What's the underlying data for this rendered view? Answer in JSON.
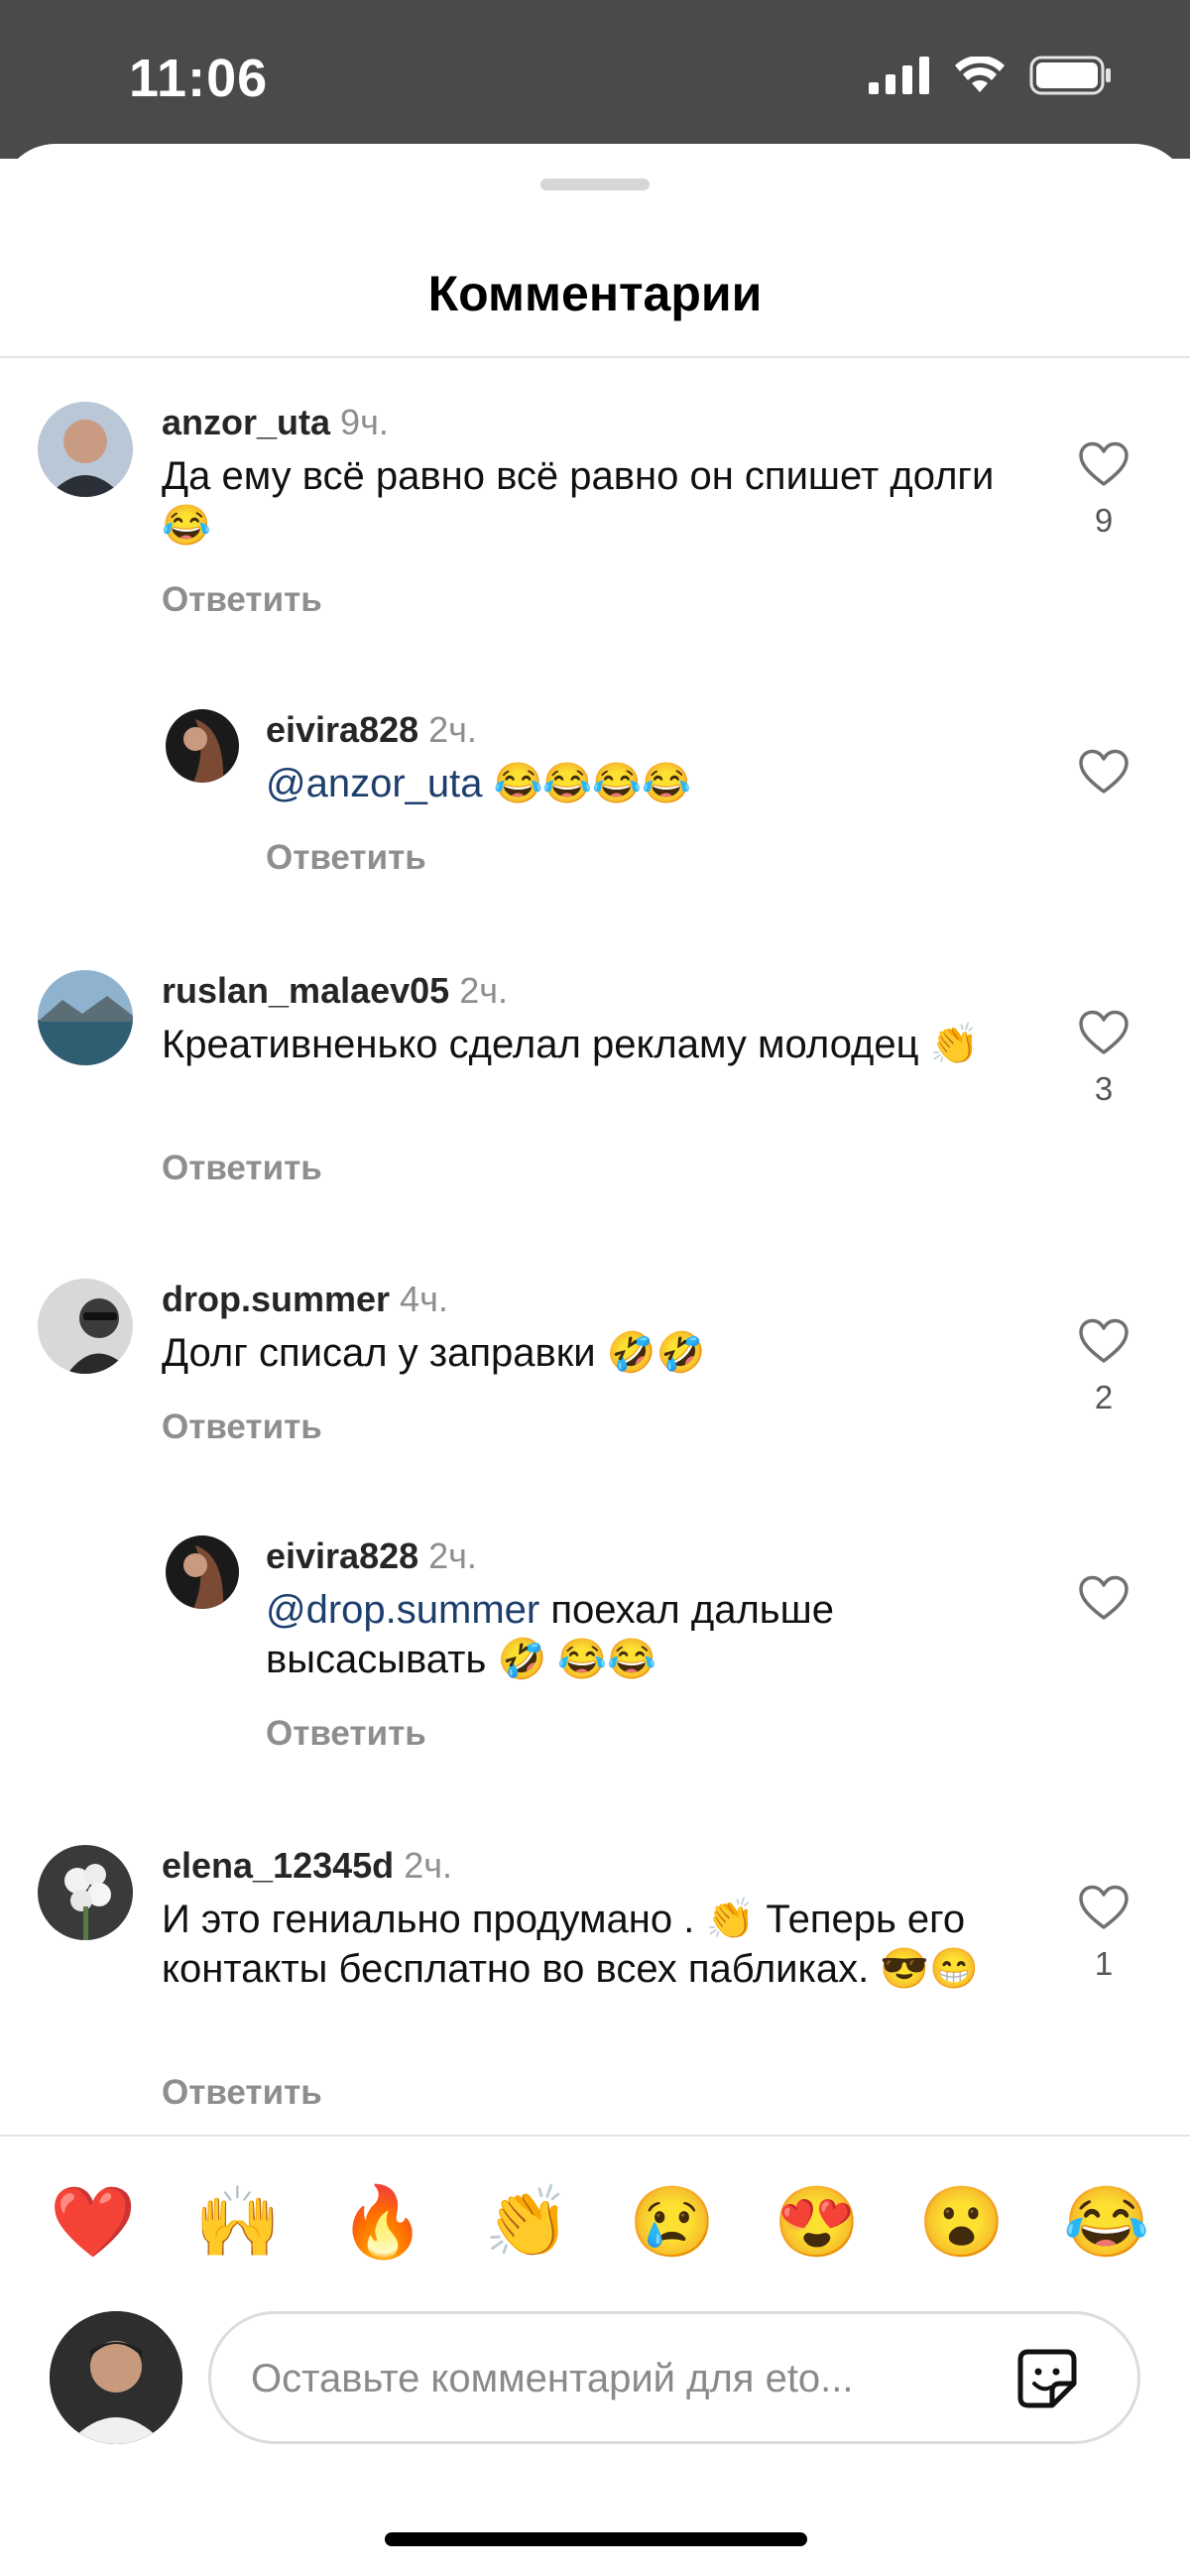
{
  "status_bar": {
    "time": "11:06"
  },
  "sheet": {
    "title": "Комментарии"
  },
  "comments": [
    {
      "username": "anzor_uta",
      "time": "9ч.",
      "text": "Да ему всё равно всё равно он спишет долги😂",
      "reply": "Ответить",
      "likes": "9"
    },
    {
      "username": "eivira828",
      "time": "2ч.",
      "mention": "@anzor_uta",
      "text": " 😂😂😂😂",
      "reply": "Ответить",
      "likes": ""
    },
    {
      "username": "ruslan_malaev05",
      "time": "2ч.",
      "text": "Креативненько сделал рекламу молодец 👏",
      "reply": "Ответить",
      "likes": "3"
    },
    {
      "username": "drop.summer",
      "time": "4ч.",
      "text": "Долг списал у заправки 🤣🤣",
      "reply": "Ответить",
      "likes": "2"
    },
    {
      "username": "eivira828",
      "time": "2ч.",
      "mention": "@drop.summer",
      "text": " поехал дальше высасывать 🤣 😂😂",
      "reply": "Ответить",
      "likes": ""
    },
    {
      "username": "elena_12345d",
      "time": "2ч.",
      "text": "И это гениально продумано . 👏 Теперь его контакты бесплатно во всех пабликах. 😎😁",
      "reply": "Ответить",
      "likes": "1"
    }
  ],
  "quick_reactions": [
    "❤️",
    "🙌",
    "🔥",
    "👏",
    "😢",
    "😍",
    "😮",
    "😂"
  ],
  "composer": {
    "placeholder": "Оставьте комментарий для eto..."
  }
}
